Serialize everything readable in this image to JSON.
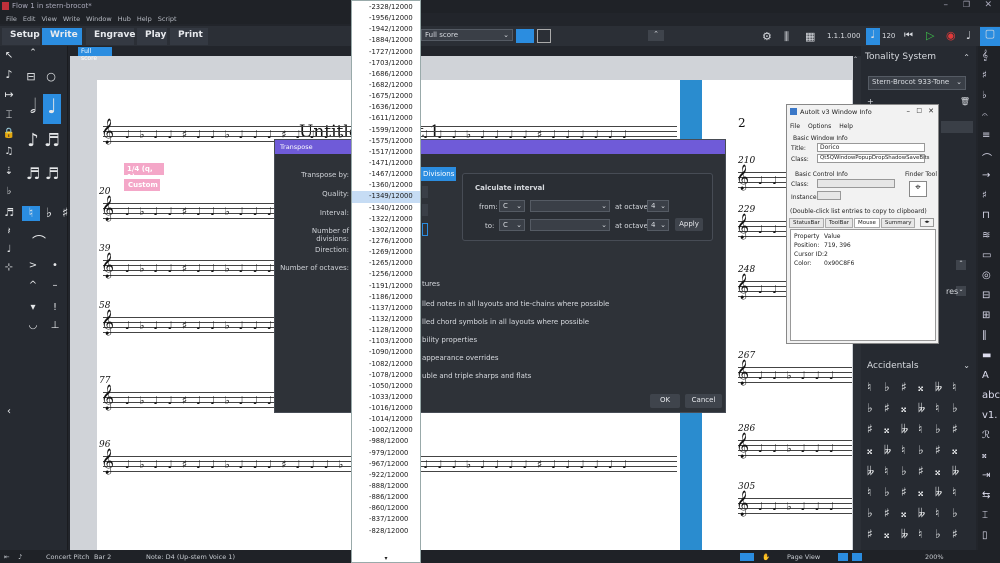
{
  "window": {
    "title": "Flow 1 in stern-brocot*"
  },
  "menu": [
    "File",
    "Edit",
    "View",
    "Write",
    "Window",
    "Hub",
    "Help",
    "Script"
  ],
  "modes": [
    "Setup",
    "Write",
    "Engrave",
    "Play",
    "Print"
  ],
  "layout_select": "Full score",
  "tab_label": "Full score",
  "tempo": "120",
  "counter": "1.1.1.000",
  "score": {
    "title": "Untitled",
    "subtitle": "t 1",
    "tag_fraction": "1/4 (q, 1)",
    "tag_custom": "Custom",
    "bars_left": [
      "20",
      "39",
      "58",
      "77",
      "96"
    ],
    "page2_num": "2",
    "bars_right": [
      "210",
      "229",
      "248",
      "267",
      "286",
      "305"
    ]
  },
  "right_panel": {
    "title": "Tonality System",
    "system": "Stern-Brocot 933-Tone",
    "accidentals": "Accidentals",
    "res": "res"
  },
  "dialog": {
    "title": "Transpose",
    "transpose_by": "Transpose by:",
    "quality": "Quality:",
    "interval": "Interval:",
    "num_divisions": "Number of divisions:",
    "direction": "Direction:",
    "num_octaves": "Number of octaves:",
    "divisions_btn": "Divisions",
    "calc_title": "Calculate interval",
    "from": "from:",
    "to": "to:",
    "at_octave": "at octave",
    "c": "C",
    "oct": "4",
    "apply": "Apply",
    "options": [
      "tures",
      "lled notes in all layouts and tie-chains where possible",
      "lled chord symbols in all layouts where possible",
      "bility properties",
      "appearance overrides",
      "uble and triple sharps and flats"
    ],
    "ok": "OK",
    "cancel": "Cancel"
  },
  "dropdown": [
    "-2328/12000",
    "-1956/12000",
    "-1942/12000",
    "-1884/12000",
    "-1727/12000",
    "-1703/12000",
    "-1686/12000",
    "-1682/12000",
    "-1675/12000",
    "-1636/12000",
    "-1611/12000",
    "-1599/12000",
    "-1575/12000",
    "-1517/12000",
    "-1471/12000",
    "-1467/12000",
    "-1360/12000",
    "-1349/12000",
    "-1340/12000",
    "-1322/12000",
    "-1302/12000",
    "-1276/12000",
    "-1269/12000",
    "-1265/12000",
    "-1256/12000",
    "-1191/12000",
    "-1186/12000",
    "-1137/12000",
    "-1132/12000",
    "-1128/12000",
    "-1103/12000",
    "-1090/12000",
    "-1082/12000",
    "-1078/12000",
    "-1050/12000",
    "-1033/12000",
    "-1016/12000",
    "-1014/12000",
    "-1002/12000",
    "-988/12000",
    "-979/12000",
    "-967/12000",
    "-922/12000",
    "-888/12000",
    "-886/12000",
    "-860/12000",
    "-837/12000",
    "-828/12000"
  ],
  "dropdown_selected": "-1349/12000",
  "autoit": {
    "title": "AutoIt v3 Window Info",
    "menu": [
      "File",
      "Options",
      "Help"
    ],
    "basic_window": "Basic Window Info",
    "title_lbl": "Title:",
    "title_val": "Dorico",
    "class_lbl": "Class:",
    "class_val": "Qt5QWindowPopupDropShadowSaveBits",
    "basic_control": "Basic Control Info",
    "finder": "Finder Tool",
    "ctrl_class": "Class:",
    "instance": "Instance:",
    "hint": "(Double-click list entries to copy to clipboard)",
    "tabs": [
      "StatusBar",
      "ToolBar",
      "Mouse",
      "Summary"
    ],
    "props": [
      [
        "Property",
        "Value"
      ],
      [
        "Position:",
        "719, 396"
      ],
      [
        "Cursor ID:",
        "2"
      ],
      [
        "Color:",
        "0x90C8F6"
      ]
    ]
  },
  "status": {
    "concert": "Concert Pitch",
    "bar": "Bar 2",
    "note": "Note: D4 (Up-stem Voice 1)",
    "view": "Page View",
    "zoom": "200%"
  }
}
